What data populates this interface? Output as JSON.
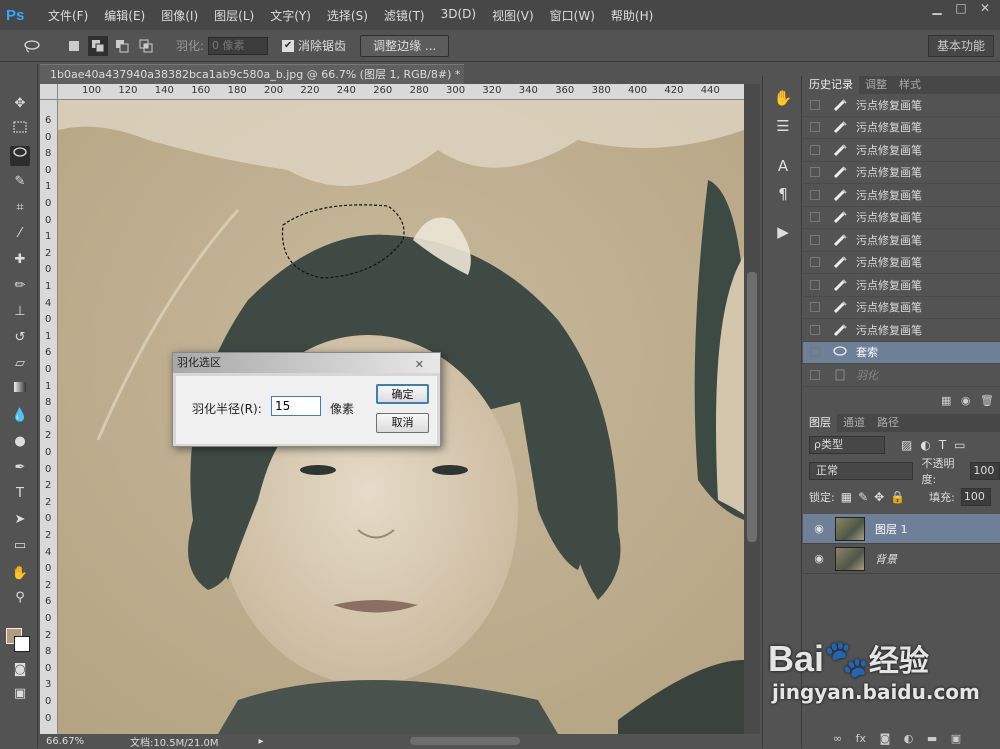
{
  "app": {
    "logo": "Ps"
  },
  "menu": [
    "文件(F)",
    "编辑(E)",
    "图像(I)",
    "图层(L)",
    "文字(Y)",
    "选择(S)",
    "滤镜(T)",
    "3D(D)",
    "视图(V)",
    "窗口(W)",
    "帮助(H)"
  ],
  "window_buttons": [
    "▁",
    "□",
    "✕"
  ],
  "options": {
    "feather_label": "羽化:",
    "feather_value": "0 像素",
    "antialias_label": "消除锯齿",
    "refine_edge_label": "调整边缘 ...",
    "workspace_label": "基本功能"
  },
  "document": {
    "tab_title": "1b0ae40a437940a38382bca1ab9c580a_b.jpg @ 66.7% (图层 1, RGB/8#) *",
    "close_glyph": "✕",
    "ruler_h": [
      "100",
      "120",
      "140",
      "160",
      "180",
      "200",
      "220",
      "240",
      "260",
      "280",
      "300",
      "320",
      "340",
      "360",
      "380",
      "400",
      "420",
      "440"
    ],
    "ruler_v": [
      "6",
      "0",
      "8",
      "0",
      "1",
      "0",
      "0",
      "1",
      "2",
      "0",
      "1",
      "4",
      "0",
      "1",
      "6",
      "0",
      "1",
      "8",
      "0",
      "2",
      "0",
      "0",
      "2",
      "2",
      "0",
      "2",
      "4",
      "0",
      "2",
      "6",
      "0",
      "2",
      "8",
      "0",
      "3",
      "0",
      "0"
    ]
  },
  "status": {
    "zoom": "66.67%",
    "doc": "文档:10.5M/21.0M"
  },
  "dialog": {
    "title": "羽化选区",
    "close": "✕",
    "label": "羽化半径(R):",
    "value": "15",
    "unit": "像素",
    "ok": "确定",
    "cancel": "取消"
  },
  "history": {
    "tabs": [
      "历史记录",
      "调整",
      "样式"
    ],
    "items": [
      {
        "label": "污点修复画笔",
        "state": "normal"
      },
      {
        "label": "污点修复画笔",
        "state": "normal"
      },
      {
        "label": "污点修复画笔",
        "state": "normal"
      },
      {
        "label": "污点修复画笔",
        "state": "normal"
      },
      {
        "label": "污点修复画笔",
        "state": "normal"
      },
      {
        "label": "污点修复画笔",
        "state": "normal"
      },
      {
        "label": "污点修复画笔",
        "state": "normal"
      },
      {
        "label": "污点修复画笔",
        "state": "normal"
      },
      {
        "label": "污点修复画笔",
        "state": "normal"
      },
      {
        "label": "污点修复画笔",
        "state": "normal"
      },
      {
        "label": "污点修复画笔",
        "state": "normal"
      },
      {
        "label": "套索",
        "state": "selected"
      },
      {
        "label": "羽化",
        "state": "disabled"
      }
    ]
  },
  "layers": {
    "tabs": [
      "图层",
      "通道",
      "路径"
    ],
    "filter_label": "ρ类型",
    "blend_mode": "正常",
    "opacity_label": "不透明度:",
    "opacity_value": "100",
    "lock_label": "锁定:",
    "fill_label": "填充:",
    "fill_value": "100",
    "items": [
      {
        "name": "图层 1",
        "selected": true
      },
      {
        "name": "背景",
        "selected": false
      }
    ]
  },
  "watermark": {
    "brand": "Bai",
    "brand2": "经验",
    "url": "jingyan.baidu.com"
  }
}
